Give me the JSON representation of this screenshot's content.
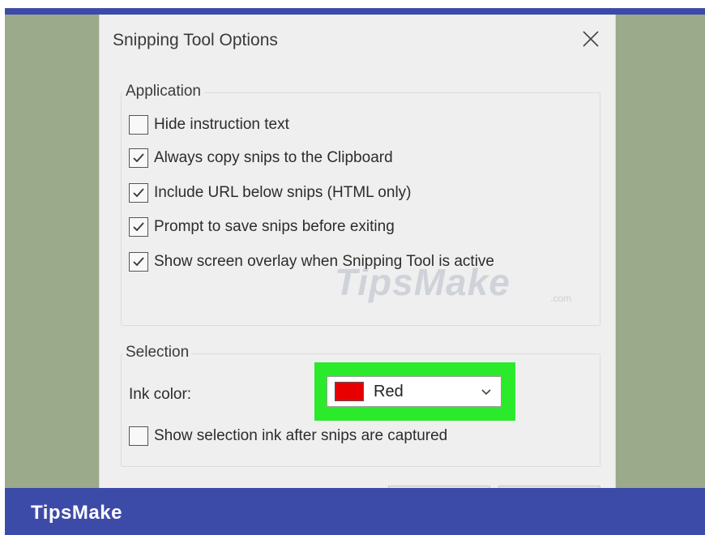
{
  "dialog": {
    "title": "Snipping Tool Options",
    "close_icon": "close-icon"
  },
  "application": {
    "legend": "Application",
    "options": [
      {
        "label": "Hide instruction text",
        "checked": false
      },
      {
        "label": "Always copy snips to the Clipboard",
        "checked": true
      },
      {
        "label": "Include URL below snips (HTML only)",
        "checked": true
      },
      {
        "label": "Prompt to save snips before exiting",
        "checked": true
      },
      {
        "label": "Show screen overlay when Snipping Tool is active",
        "checked": true
      }
    ]
  },
  "selection": {
    "legend": "Selection",
    "ink_label": "Ink color:",
    "ink_value": "Red",
    "ink_swatch_color": "#e80000",
    "highlight_color": "#2bea2b",
    "show_ink": {
      "label": "Show selection ink after snips are captured",
      "checked": false
    }
  },
  "watermark": {
    "main": "TipsMake",
    "suffix": ".com"
  },
  "footer": {
    "brand": "TipsMake"
  },
  "colors": {
    "brand_bar": "#3d4ba8",
    "desktop": "#9aaa8a",
    "dialog_bg": "#efefef"
  }
}
